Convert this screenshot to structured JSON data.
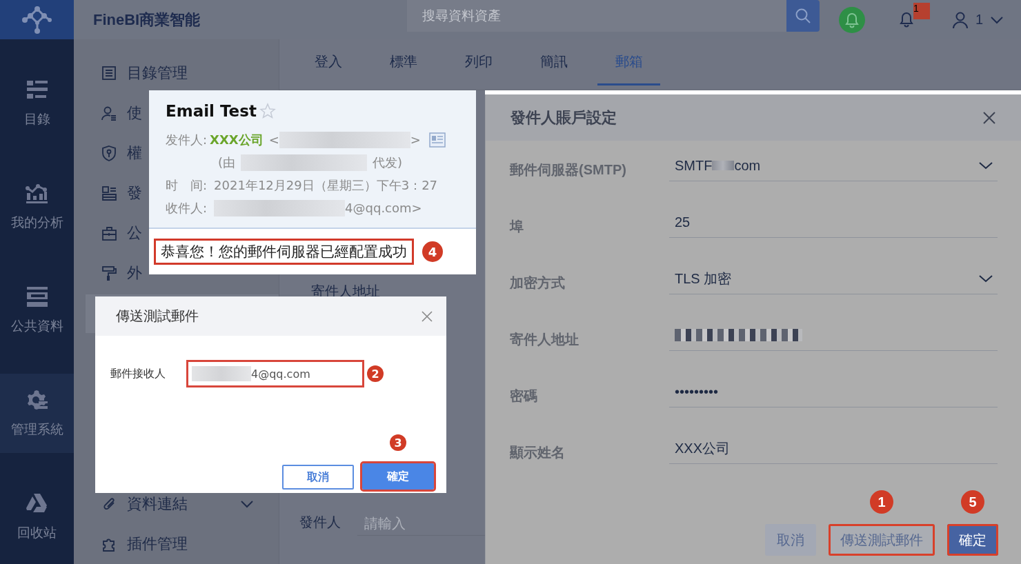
{
  "rail": {
    "items": [
      {
        "label": "目錄",
        "selected": false
      },
      {
        "label": "我的分析",
        "selected": false
      },
      {
        "label": "公共資料",
        "selected": false
      },
      {
        "label": "管理系統",
        "selected": true
      },
      {
        "label": "回收站",
        "selected": false
      }
    ]
  },
  "topbar": {
    "title": "FineBI商業智能",
    "search": {
      "placeholder": "搜尋資料資產"
    },
    "notification_count": "1",
    "user": "1"
  },
  "admin_menu": {
    "items": [
      {
        "label": "目錄管理"
      },
      {
        "label": "使"
      },
      {
        "label": "權"
      },
      {
        "label": "發"
      },
      {
        "label": "公"
      },
      {
        "label": "外"
      },
      {
        "label": "資料連結",
        "expanded": false
      },
      {
        "label": "插件管理"
      }
    ]
  },
  "tabs": [
    {
      "label": "登入",
      "selected": false
    },
    {
      "label": "標準",
      "selected": false
    },
    {
      "label": "列印",
      "selected": false
    },
    {
      "label": "簡訊",
      "selected": false
    },
    {
      "label": "郵箱",
      "selected": true
    }
  ],
  "main_form": {
    "peek_label": "寄件人地址",
    "sender_label": "發件人",
    "sender_placeholder": "請輸入"
  },
  "settings_panel": {
    "title": "發件人賬戶設定",
    "fields": [
      {
        "label": "郵件伺服器(SMTP)",
        "kind": "select",
        "value": "SMTF",
        "tail": "com"
      },
      {
        "label": "埠",
        "kind": "text",
        "value": "25"
      },
      {
        "label": "加密方式",
        "kind": "select",
        "value": "TLS 加密"
      },
      {
        "label": "寄件人地址",
        "kind": "redacted"
      },
      {
        "label": "密碼",
        "kind": "text",
        "value": "•••••••••"
      },
      {
        "label": "顯示姓名",
        "kind": "text",
        "value": "XXX公司"
      }
    ],
    "buttons": [
      {
        "label": "取消",
        "kind": "secondary",
        "highlighted": false
      },
      {
        "label": "傳送測試郵件",
        "kind": "secondary",
        "highlighted": true,
        "step": "1"
      },
      {
        "label": "確定",
        "kind": "primary",
        "highlighted": true,
        "step": "5"
      }
    ]
  },
  "email_preview": {
    "subject": "Email Test",
    "sender_label": "发件人:",
    "sender_name": "XXX公司",
    "open_bracket": "<",
    "close_bracket": ">",
    "via_open": "(由",
    "via_close": "代发)",
    "time_label": "时　间:",
    "time": "2021年12月29日（星期三）下午3：27",
    "recipient_label": "收件人:",
    "recipient_tail": "4@qq.com>",
    "message": "恭喜您！您的郵件伺服器已經配置成功",
    "step": "4"
  },
  "test_dialog": {
    "title": "傳送測試郵件",
    "field_label": "郵件接收人",
    "field_value_tail": "4@qq.com",
    "field_step": "2",
    "buttons": [
      {
        "label": "取消",
        "kind": "secondary",
        "highlighted": false
      },
      {
        "label": "確定",
        "kind": "primary",
        "highlighted": true,
        "step": "3"
      }
    ]
  }
}
